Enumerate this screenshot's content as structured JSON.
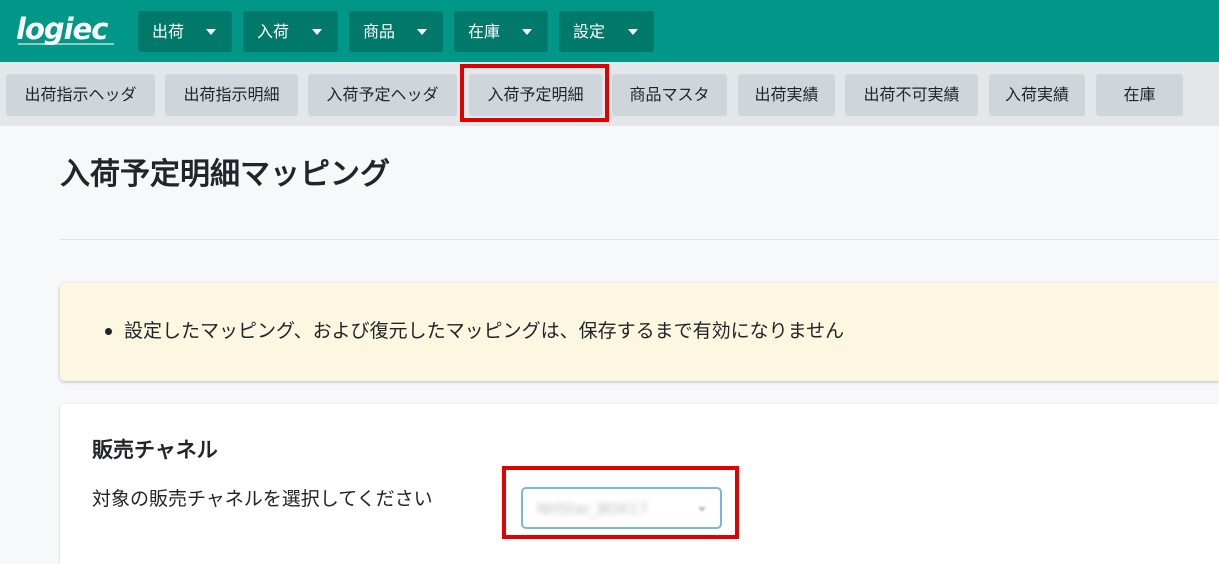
{
  "app": {
    "logo": "logiec"
  },
  "top_menu": [
    {
      "label": "出荷"
    },
    {
      "label": "入荷"
    },
    {
      "label": "商品"
    },
    {
      "label": "在庫"
    },
    {
      "label": "設定"
    }
  ],
  "tabs": [
    {
      "label": "出荷指示ヘッダ"
    },
    {
      "label": "出荷指示明細"
    },
    {
      "label": "入荷予定ヘッダ"
    },
    {
      "label": "入荷予定明細",
      "active": true
    },
    {
      "label": "商品マスタ"
    },
    {
      "label": "出荷実績"
    },
    {
      "label": "出荷不可実績"
    },
    {
      "label": "入荷実績"
    },
    {
      "label": "在庫"
    }
  ],
  "page": {
    "title": "入荷予定明細マッピング"
  },
  "notice": {
    "text": "設定したマッピング、および復元したマッピングは、保存するまで有効になりません"
  },
  "sales_channel": {
    "title": "販売チャネル",
    "label": "対象の販売チャネルを選択してください",
    "selected_value": "NHStar_BOX17"
  },
  "colors": {
    "nav_bg": "#009688",
    "nav_button": "#00796b",
    "tab_bg": "#cfd6db",
    "notice_bg": "#fdf6e0",
    "highlight": "#e00000"
  }
}
